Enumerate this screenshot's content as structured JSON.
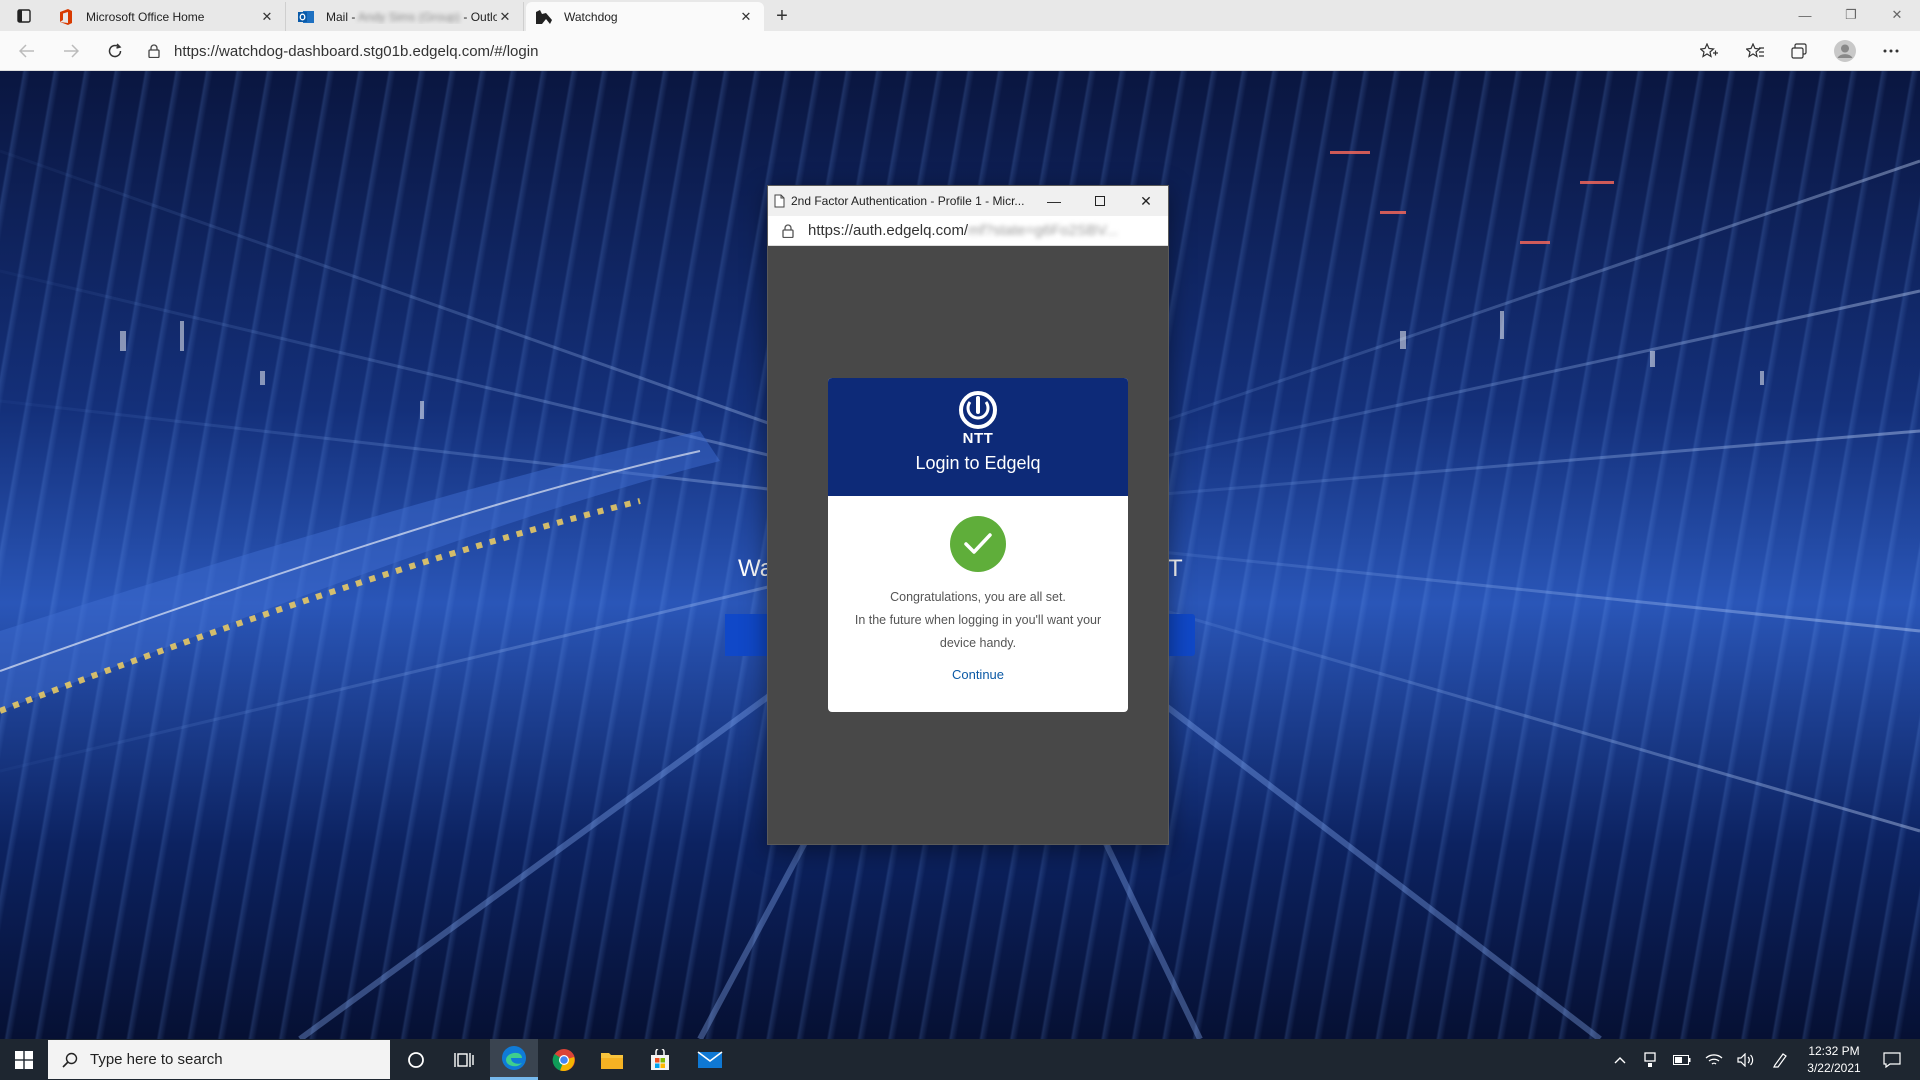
{
  "browser": {
    "tabs": [
      {
        "title": "Microsoft Office Home",
        "icon": "office-icon",
        "active": false
      },
      {
        "title": "Mail - Andy Sims (Group) - Outlook",
        "icon": "outlook-icon",
        "active": false
      },
      {
        "title": "Watchdog",
        "icon": "watchdog-icon",
        "active": true
      }
    ],
    "url": "https://watchdog-dashboard.stg01b.edgelq.com/#/login"
  },
  "background_page": {
    "heading_left": "Wa",
    "heading_right": "T"
  },
  "popup": {
    "title": "2nd Factor Authentication - Profile 1 - Micr...",
    "url_host": "https://auth.edgelq.com/",
    "url_rest": "mf?state=g6Fo2SBV...",
    "card": {
      "brand": "NTT",
      "title": "Login to Edgelq",
      "message_line1": "Congratulations, you are all set.",
      "message_line2": "In the future when logging in you'll want your device handy.",
      "continue_label": "Continue"
    }
  },
  "taskbar": {
    "search_placeholder": "Type here to search",
    "time": "12:32 PM",
    "date": "3/22/2021"
  },
  "colors": {
    "card_header": "#0d2a78",
    "success_green": "#5fae3a",
    "link_blue": "#0c5aa6",
    "taskbar": "#1e2630"
  }
}
